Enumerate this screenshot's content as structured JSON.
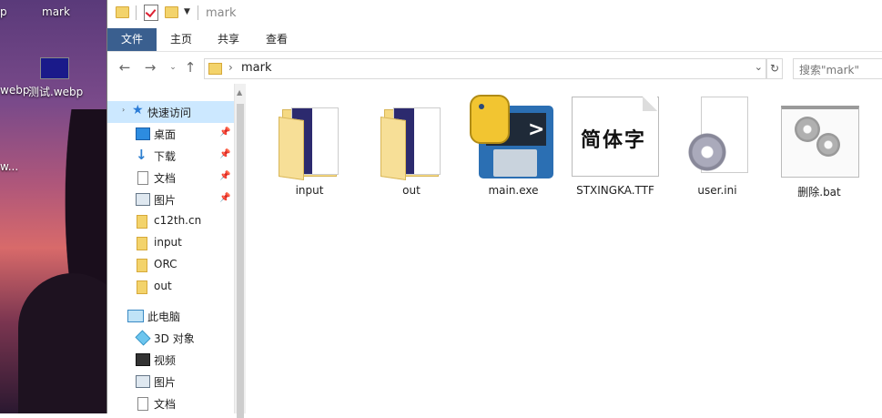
{
  "desktop": {
    "icon_labels": [
      "p",
      "mark",
      "webp",
      "测试.webp",
      "w..."
    ]
  },
  "window": {
    "title": "mark"
  },
  "ribbon": {
    "tabs": [
      "文件",
      "主页",
      "共享",
      "查看"
    ]
  },
  "address": {
    "path": "mark",
    "search_placeholder": "搜索\"mark\""
  },
  "nav": {
    "quick_access": "快速访问",
    "items": [
      {
        "label": "桌面",
        "pinned": true
      },
      {
        "label": "下载",
        "pinned": true
      },
      {
        "label": "文档",
        "pinned": true
      },
      {
        "label": "图片",
        "pinned": true
      },
      {
        "label": "c12th.cn",
        "pinned": false
      },
      {
        "label": "input",
        "pinned": false
      },
      {
        "label": "ORC",
        "pinned": false
      },
      {
        "label": "out",
        "pinned": false
      }
    ],
    "this_pc": "此电脑",
    "pc_items": [
      "3D 对象",
      "视频",
      "图片",
      "文档"
    ]
  },
  "files": [
    {
      "name": "input",
      "type": "folder"
    },
    {
      "name": "out",
      "type": "folder"
    },
    {
      "name": "main.exe",
      "type": "exe"
    },
    {
      "name": "STXINGKA.TTF",
      "type": "font",
      "preview": "简体字"
    },
    {
      "name": "user.ini",
      "type": "ini"
    },
    {
      "name": "删除.bat",
      "type": "bat"
    }
  ],
  "colors": {
    "selection": "#cce8ff",
    "file_tab": "#3a5f8f"
  }
}
